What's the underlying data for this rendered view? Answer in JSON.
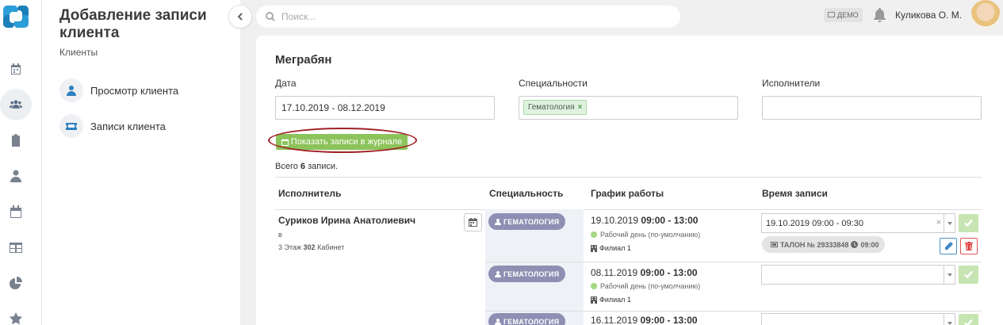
{
  "colors": {
    "accent": "#8cc35a",
    "badge": "#8d90b3",
    "highlight": "#a02024",
    "link_icon": "#2f7fbe"
  },
  "rail": {
    "icons": [
      "calendar-icon",
      "users-icon",
      "clipboard-icon",
      "doctor-icon",
      "schedule-icon",
      "table-icon",
      "pie-chart-icon",
      "star-icon"
    ],
    "active": "users-icon"
  },
  "side": {
    "title": "Добавление записи клиента",
    "subtitle": "Клиенты",
    "links": [
      {
        "label": "Просмотр клиента",
        "icon": "user-icon"
      },
      {
        "label": "Записи клиента",
        "icon": "ticket-icon"
      }
    ]
  },
  "topbar": {
    "search_placeholder": "Поиск...",
    "demo_label": "ДЕМО",
    "user_name": "Куликова О. М."
  },
  "main": {
    "client_name": "Меграбян",
    "filters": {
      "date_label": "Дата",
      "date_value": "17.10.2019 - 08.12.2019",
      "spec_label": "Специальности",
      "spec_tag": "Гематология",
      "spec_tag_remove": "×",
      "exec_label": "Исполнители",
      "exec_value": ""
    },
    "show_button": "Показать записи в журнале",
    "total_prefix": "Всего",
    "total_count": "6",
    "total_suffix": "записи.",
    "table": {
      "headers": [
        "Исполнитель",
        "Специальность",
        "График работы",
        "Время записи"
      ],
      "executor": {
        "name": "Суриков Ирина Анатолиевич",
        "sub": "в",
        "floor": "3 Этаж",
        "room_no": "302",
        "room_label": "Кабинет"
      },
      "rows": [
        {
          "spec": "ГЕМАТОЛОГИЯ",
          "date": "19.10.2019",
          "time": "09:00 - 13:00",
          "day_type": "Рабочий день (по-умолчанию)",
          "branch": "Филиал 1",
          "selected_slot": "19.10.2019 09:00 - 09:30",
          "clear": "×",
          "ticket": "ТАЛОН № 29333848",
          "ticket_time": "09:00"
        },
        {
          "spec": "ГЕМАТОЛОГИЯ",
          "date": "08.11.2019",
          "time": "09:00 - 13:00",
          "day_type": "Рабочий день (по-умолчанию)",
          "branch": "Филиал 1",
          "selected_slot": ""
        },
        {
          "spec": "ГЕМАТОЛОГИЯ",
          "date": "16.11.2019",
          "time": "09:00 - 13:00",
          "selected_slot": ""
        }
      ]
    }
  }
}
